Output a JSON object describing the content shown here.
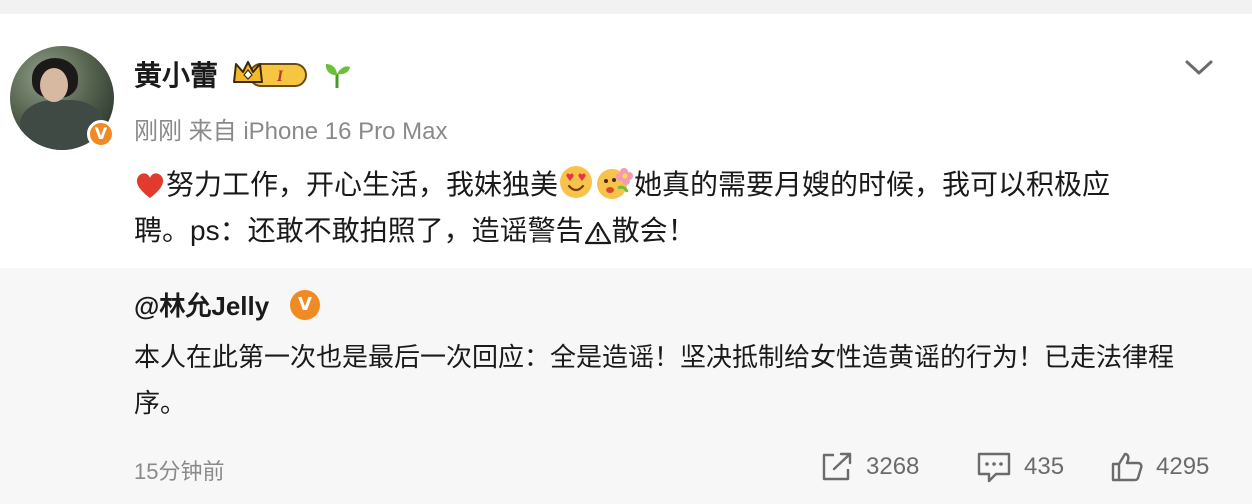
{
  "post": {
    "username": "黄小蕾",
    "level_badge": "I",
    "verified_mark": "V",
    "meta": "刚刚 来自 iPhone 16 Pro Max",
    "content_line1": "努力工作，开心生活，我妹独美",
    "content_line1b": "她真的需要月嫂的时候，我可以积极应",
    "content_line2": "聘。ps：还敢不敢拍照了，造谣警告",
    "content_line2b": "散会！",
    "icons": [
      "heart-emoji",
      "heart-eyes-emoji",
      "flower-emoji",
      "warning-icon",
      "crown-badge-icon",
      "sprout-icon",
      "chevron-down-icon"
    ]
  },
  "quote": {
    "username": "@林允Jelly",
    "verified_mark": "V",
    "text": "本人在此第一次也是最后一次回应：全是造谣！坚决抵制给女性造黄谣的行为！已走法律程序。"
  },
  "footer": {
    "time": "15分钟前",
    "share_count": "3268",
    "comment_count": "435",
    "like_count": "4295"
  },
  "colors": {
    "verified_orange": "#f08a24",
    "meta_gray": "#8a8a8a",
    "quote_bg": "#f7f7f7"
  }
}
